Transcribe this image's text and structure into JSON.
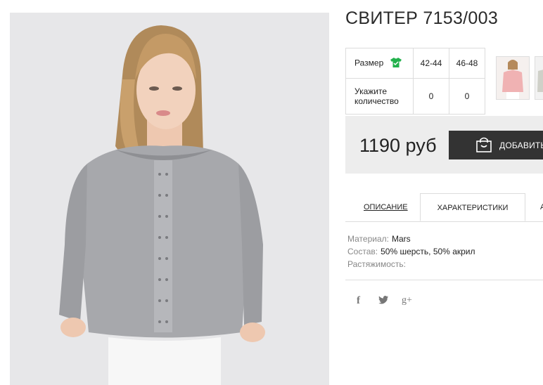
{
  "product": {
    "title": "СВИТЕР 7153/003",
    "image_alt": "Woman in grey knit sweater"
  },
  "size_table": {
    "size_label": "Размер",
    "qty_label": "Укажите количество",
    "sizes": [
      "42-44",
      "46-48"
    ],
    "quantities": [
      "0",
      "0"
    ]
  },
  "price": {
    "value": "1190 руб",
    "add_button": "ДОБАВИТЬ"
  },
  "tabs": {
    "description": "ОПИСАНИЕ",
    "characteristics": "ХАРАКТЕРИСТИКИ",
    "more": "А"
  },
  "specs": [
    {
      "key": "Материал:",
      "value": "Mars"
    },
    {
      "key": "Состав:",
      "value": "50% шерсть, 50% акрил"
    },
    {
      "key": "Растяжимость:",
      "value": ""
    }
  ],
  "social": {
    "facebook": "f",
    "google_plus": "g+"
  },
  "colors": {
    "button_bg": "#333333",
    "price_box_bg": "#ededed",
    "shirt_icon": "#22b14c"
  },
  "icons": [
    "shirt-icon",
    "shopping-bag-icon",
    "facebook-icon",
    "twitter-icon",
    "google-plus-icon"
  ]
}
